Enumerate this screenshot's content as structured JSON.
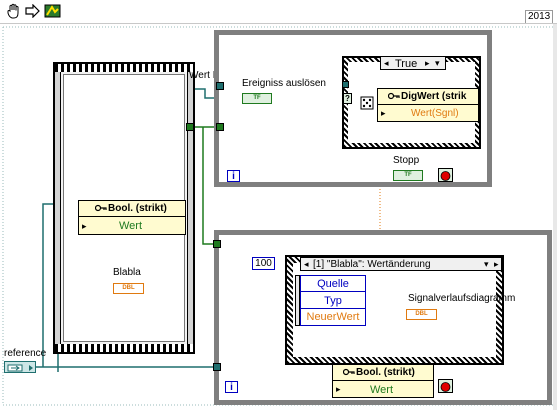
{
  "toolbar": {
    "version": "2013"
  },
  "colors": {
    "bool_wire": "#1f7a1f",
    "refnum_wire": "#1f6f6f",
    "dbl_wire": "#e07a10",
    "loop_border": "#7f7f7f",
    "stop": "#e00000"
  },
  "left_structure": {
    "ref_label": "Wert R",
    "prop_node": {
      "title": "Bool. (strikt)",
      "row": "Wert"
    },
    "indicator_label": "Blabla",
    "indicator_type": "DBL"
  },
  "reference": {
    "label": "reference"
  },
  "top_loop": {
    "label_event": "Ereigniss auslösen",
    "bool_const": "TF",
    "case_selector": "True",
    "prop_node": {
      "title": "DigWert (strik",
      "row": "Wert(Sgnl)"
    },
    "question": "?",
    "stop_label": "Stopp",
    "stop_type": "TF",
    "loop_iter": "i"
  },
  "bottom_loop": {
    "timeout": "100",
    "event_case": "[1] \"Blabla\": Wertänderung",
    "event_data": [
      "Quelle",
      "Typ",
      "NeuerWert"
    ],
    "chart_label": "Signalverlaufsdiagramm",
    "chart_type": "DBL",
    "prop_node": {
      "title": "Bool. (strikt)",
      "row": "Wert"
    },
    "loop_iter": "i"
  }
}
